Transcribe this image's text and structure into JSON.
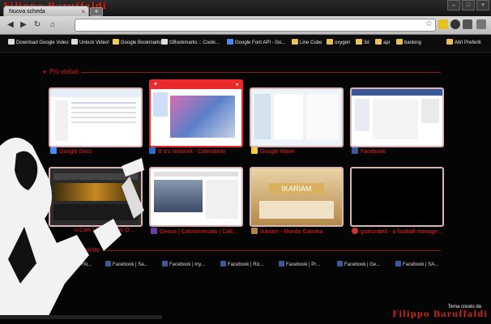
{
  "window": {
    "brand": "Filippo Baruffaldi"
  },
  "tabs": [
    {
      "label": "Nuova scheda"
    }
  ],
  "toolbar": {
    "url": ""
  },
  "bookmarks": [
    {
      "label": "Download Google Video",
      "icon": "page-icon"
    },
    {
      "label": "Unlock Video!",
      "icon": "page-icon"
    },
    {
      "label": "Google Bookmarks",
      "icon": "page-icon"
    },
    {
      "label": "GBookmarks :: Cooki...",
      "icon": "page-icon"
    },
    {
      "label": "Google Font API - Go...",
      "icon": "page-icon"
    },
    {
      "label": "Line Cube",
      "icon": "folder-icon"
    },
    {
      "label": "oxygen",
      "icon": "folder-icon"
    },
    {
      "label": "3d",
      "icon": "folder-icon"
    },
    {
      "label": "api",
      "icon": "folder-icon"
    },
    {
      "label": "banking",
      "icon": "folder-icon"
    },
    {
      "label": "Altri Preferiti",
      "icon": "folder-icon"
    }
  ],
  "most_visited": {
    "title": "Più visitati",
    "items": [
      {
        "label": "Google Docs",
        "fav": "#4a8af4"
      },
      {
        "label": "B        d's Network - Calendario",
        "fav": "#2a6dc9"
      },
      {
        "label": "Google Wave",
        "fav": "#ffcc33"
      },
      {
        "label": "Facebook",
        "fav": "#3b5998"
      },
      {
        "label": "n.Com | Film Gratis O...",
        "fav": "#777"
      },
      {
        "label": "Genoa | Calciomercato | Calc...",
        "fav": "#6a3aa5"
      },
      {
        "label": "Ikariam - Mondo Gamma",
        "fav": "#b58040"
      },
      {
        "label": "gsaturated - a football manage...",
        "fav": "#c33"
      }
    ]
  },
  "recent": {
    "title": "Chiuse di recente",
    "items": [
      {
        "label": "Facebook | Fili..."
      },
      {
        "label": "Facebook | Sa..."
      },
      {
        "label": "Facebook | my..."
      },
      {
        "label": "Facebook | Ric..."
      },
      {
        "label": "Facebook | Pr..."
      },
      {
        "label": "Facebook | Ge..."
      },
      {
        "label": "Facebook | SA..."
      }
    ]
  },
  "footer": {
    "theme_label": "Tema creato da",
    "brand": "Filippo Baruffaldi"
  }
}
